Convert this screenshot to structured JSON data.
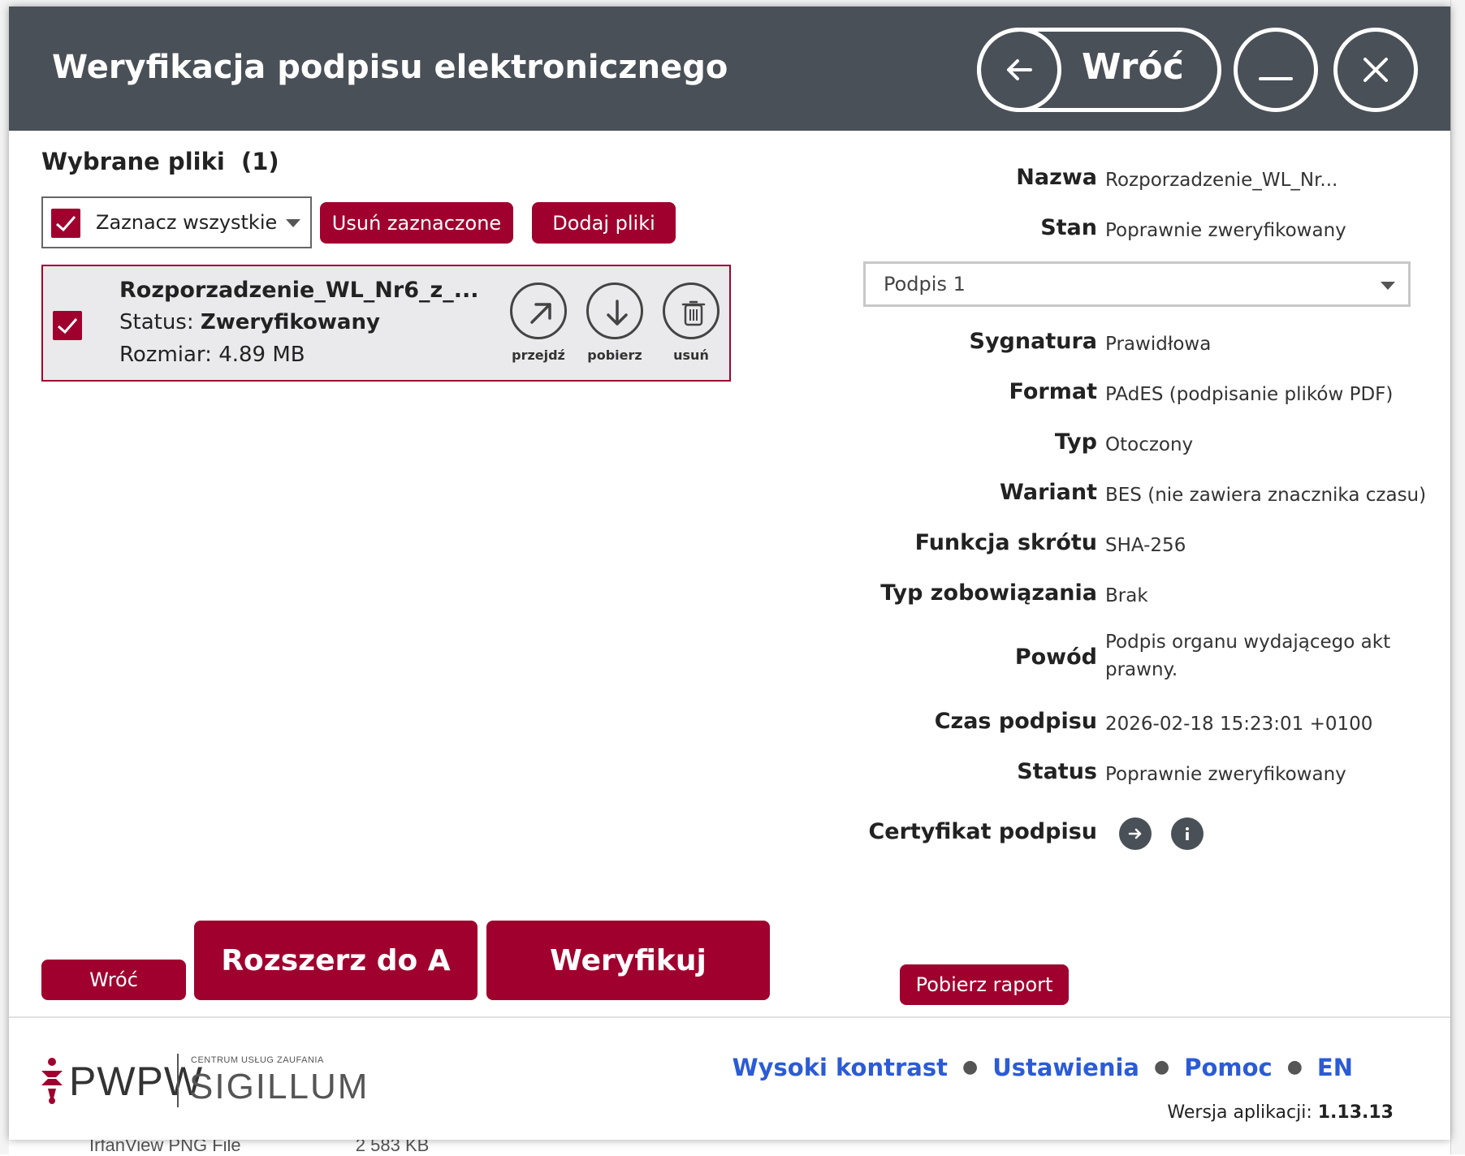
{
  "window": {
    "title": "Weryfikacja podpisu elektronicznego",
    "back_label": "Wróć"
  },
  "files": {
    "section_title": "Wybrane pliki  (1)",
    "select_all_label": "Zaznacz wszystkie",
    "remove_selected_label": "Usuń zaznaczone",
    "add_files_label": "Dodaj pliki",
    "items": [
      {
        "name": "Rozporzadzenie_WL_Nr6_z_...",
        "status_prefix": "Status: ",
        "status": "Zweryfikowany",
        "size": "Rozmiar: 4.89 MB",
        "actions": {
          "go": "przejdź",
          "download": "pobierz",
          "delete": "usuń"
        }
      }
    ]
  },
  "bottom_buttons": {
    "back": "Wróć",
    "extend": "Rozszerz do A",
    "verify": "Weryfikuj"
  },
  "details": {
    "name_label": "Nazwa",
    "name_value": "Rozporzadzenie_WL_Nr...",
    "state_label": "Stan",
    "state_value": "Poprawnie zweryfikowany",
    "signature_select": "Podpis 1",
    "signature": [
      {
        "label": "Sygnatura",
        "value": "Prawidłowa"
      },
      {
        "label": "Format",
        "value": "PAdES (podpisanie plików PDF)"
      },
      {
        "label": "Typ",
        "value": "Otoczony"
      },
      {
        "label": "Wariant",
        "value": "BES (nie zawiera znacznika czasu)"
      },
      {
        "label": "Funkcja skrótu",
        "value": "SHA-256"
      },
      {
        "label": "Typ zobowiązania",
        "value": "Brak"
      },
      {
        "label": "Powód",
        "value": "Podpis organu wydającego akt prawny."
      },
      {
        "label": "Czas podpisu",
        "value": "2026-02-18 15:23:01 +0100"
      },
      {
        "label": "Status",
        "value": "Poprawnie zweryfikowany"
      }
    ],
    "certificate_label": "Certyfikat podpisu",
    "report_button": "Pobierz raport"
  },
  "footer": {
    "logo_left": "PWPW",
    "logo_small": "CENTRUM USŁUG ZAUFANIA",
    "logo_right": "SIGILLUM",
    "links": [
      "Wysoki kontrast",
      "Ustawienia",
      "Pomoc",
      "EN"
    ],
    "version_label": "Wersja aplikacji: ",
    "version_value": "1.13.13"
  },
  "background": {
    "file_type": "IrfanView PNG File",
    "file_size": "2 583 KB"
  },
  "colors": {
    "accent": "#a0002e",
    "titlebar": "#4a5057",
    "link": "#2b5bd7"
  }
}
